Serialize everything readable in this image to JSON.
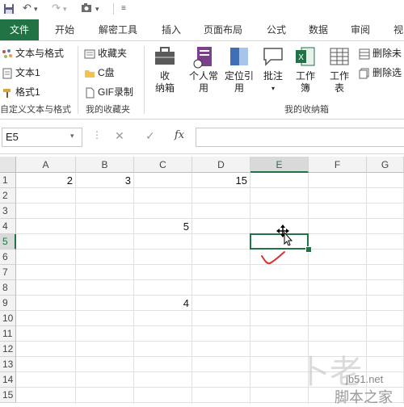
{
  "ribbon_tabs": [
    "文件",
    "开始",
    "解密工具",
    "插入",
    "页面布局",
    "公式",
    "数据",
    "审阅",
    "视"
  ],
  "ribbon": {
    "group1": {
      "items": [
        "文本与格式",
        "文本1",
        "格式1"
      ],
      "label": "自定义文本与格式"
    },
    "group2": {
      "items": [
        "收藏夹",
        "C盘",
        "GIF录制"
      ],
      "label": "我的收藏夹"
    },
    "group3": {
      "big_buttons": [
        {
          "line1": "收",
          "line2": "纳箱"
        },
        {
          "line1": "个人常",
          "line2": "用"
        },
        {
          "line1": "定位引",
          "line2": "用"
        },
        {
          "line1": "批注",
          "line2": ""
        },
        {
          "line1": "工作",
          "line2": "簿"
        },
        {
          "line1": "工作",
          "line2": "表"
        }
      ],
      "side_items": [
        "删除未",
        "删除选"
      ],
      "label": "我的收纳箱"
    }
  },
  "formula_bar": {
    "name_box": "E5",
    "fx_label": "fx",
    "content": ""
  },
  "sheet": {
    "columns": [
      "A",
      "B",
      "C",
      "D",
      "E",
      "F",
      "G"
    ],
    "rows": [
      "1",
      "2",
      "3",
      "4",
      "5",
      "6",
      "7",
      "8",
      "9",
      "10",
      "11",
      "12",
      "13",
      "14",
      "15"
    ],
    "selected_column": "E",
    "selected_row": "5",
    "cells": [
      {
        "ref": "A1",
        "value": "2"
      },
      {
        "ref": "B1",
        "value": "3"
      },
      {
        "ref": "D1",
        "value": "15"
      },
      {
        "ref": "C4",
        "value": "5"
      },
      {
        "ref": "C9",
        "value": "4"
      }
    ]
  },
  "watermark": {
    "site": "jb51.net",
    "name": "脚本之家"
  },
  "colors": {
    "accent": "#217346",
    "annotation": "#d9302c"
  }
}
